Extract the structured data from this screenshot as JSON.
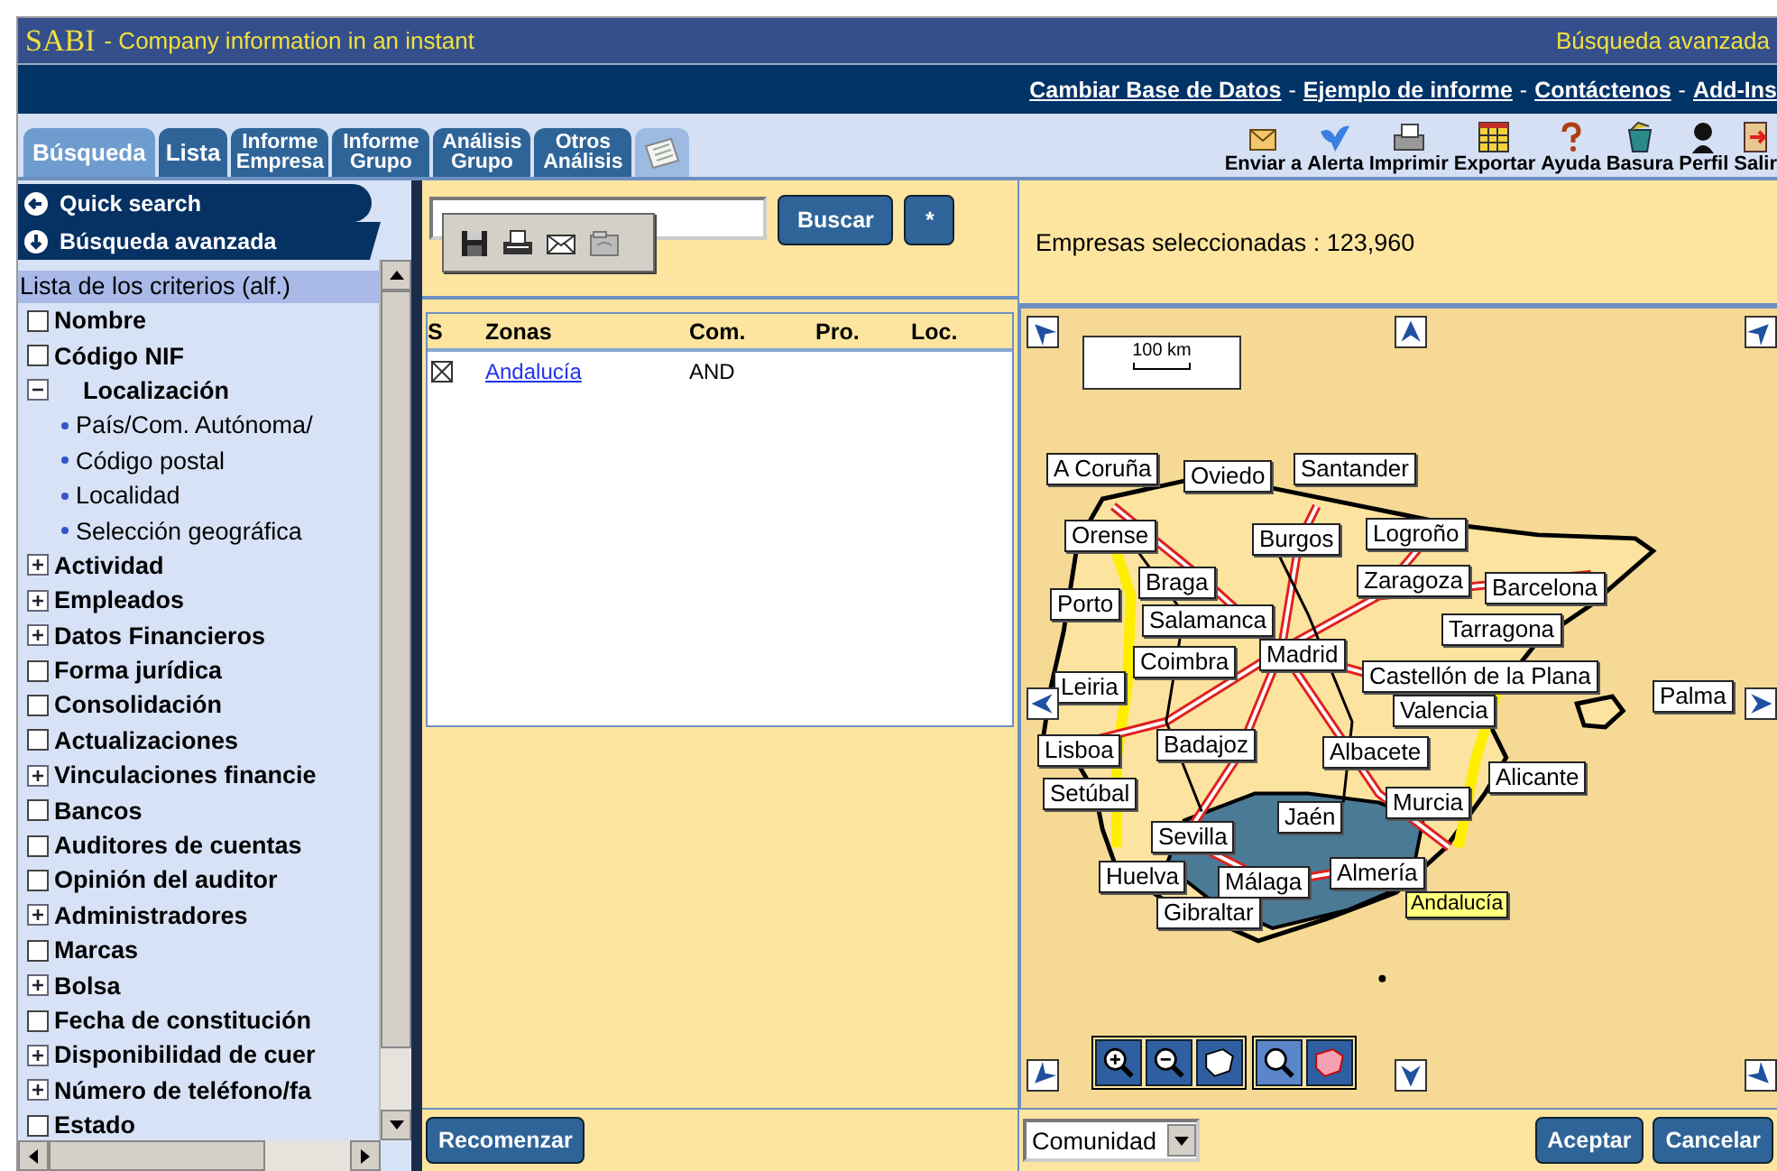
{
  "app_title": {
    "name": "SABI",
    "tagline": "- Company information in an instant",
    "mode": "Búsqueda avanzada"
  },
  "nav_links": [
    {
      "kind": "link",
      "label": "Cambiar Base de Datos"
    },
    {
      "kind": "separator",
      "label": "-"
    },
    {
      "kind": "link",
      "label": "Ejemplo de informe"
    },
    {
      "kind": "separator",
      "label": "-"
    },
    {
      "kind": "link",
      "label": "Contáctenos"
    },
    {
      "kind": "separator",
      "label": "-"
    },
    {
      "kind": "link",
      "label": "Add-Ins"
    }
  ],
  "tabs": [
    {
      "label": "Búsqueda",
      "selected": true
    },
    {
      "label": "Lista",
      "selected": false
    },
    {
      "label": "Informe Empresa",
      "selected": false
    },
    {
      "label": "Informe Grupo",
      "selected": false
    },
    {
      "label": "Análisis Grupo",
      "selected": false
    },
    {
      "label": "Otros Análisis",
      "selected": false
    }
  ],
  "toolbar": [
    {
      "kind": "send",
      "label": "Enviar a"
    },
    {
      "kind": "alert",
      "label": "Alerta"
    },
    {
      "kind": "print",
      "label": "Imprimir"
    },
    {
      "kind": "export",
      "label": "Exportar"
    },
    {
      "kind": "help",
      "label": "Ayuda"
    },
    {
      "kind": "trash",
      "label": "Basura"
    },
    {
      "kind": "profile",
      "label": "Perfil"
    },
    {
      "kind": "exit",
      "label": "Salir"
    }
  ],
  "sidebar": {
    "quick_search": "Quick search",
    "advanced_search": "Búsqueda avanzada",
    "list_title": "Lista de los criterios (alf.)",
    "criteria": [
      {
        "kind": "checkbox",
        "label": "Nombre",
        "checked": false
      },
      {
        "kind": "checkbox",
        "label": "Código NIF",
        "checked": false
      },
      {
        "kind": "group",
        "label": "Localización",
        "expanded": true,
        "children": [
          {
            "label": "País/Com. Autónoma/"
          },
          {
            "label": "Código postal"
          },
          {
            "label": "Localidad"
          },
          {
            "label": "Selección geográfica"
          }
        ]
      },
      {
        "kind": "group",
        "label": "Actividad",
        "expanded": false
      },
      {
        "kind": "group",
        "label": "Empleados",
        "expanded": false
      },
      {
        "kind": "group",
        "label": "Datos Financieros",
        "expanded": false
      },
      {
        "kind": "checkbox",
        "label": "Forma jurídica",
        "checked": false
      },
      {
        "kind": "checkbox",
        "label": "Consolidación",
        "checked": false
      },
      {
        "kind": "checkbox",
        "label": "Actualizaciones",
        "checked": false
      },
      {
        "kind": "group",
        "label": "Vinculaciones financie",
        "expanded": false
      },
      {
        "kind": "checkbox",
        "label": "Bancos",
        "checked": false
      },
      {
        "kind": "checkbox",
        "label": "Auditores de cuentas",
        "checked": false
      },
      {
        "kind": "checkbox",
        "label": "Opinión del auditor",
        "checked": false
      },
      {
        "kind": "group",
        "label": "Administradores",
        "expanded": false
      },
      {
        "kind": "checkbox",
        "label": "Marcas",
        "checked": false
      },
      {
        "kind": "group",
        "label": "Bolsa",
        "expanded": false
      },
      {
        "kind": "checkbox",
        "label": "Fecha de constitución",
        "checked": false
      },
      {
        "kind": "group",
        "label": "Disponibilidad de cuer",
        "expanded": false
      },
      {
        "kind": "group",
        "label": "Número de teléfono/fa",
        "expanded": false
      },
      {
        "kind": "checkbox",
        "label": "Estado",
        "checked": false
      }
    ]
  },
  "search": {
    "search_button": "Buscar",
    "star_button": "*"
  },
  "table": {
    "columns": [
      "S",
      "Zonas",
      "Com.",
      "Pro.",
      "Loc."
    ],
    "rows": [
      {
        "checked": true,
        "zone": "Andalucía",
        "com": "AND"
      }
    ]
  },
  "restart_button": "Recomenzar",
  "summary": "Empresas seleccionadas : 123,960",
  "map": {
    "scale": "100 km",
    "labels": [
      {
        "kind": "city",
        "text": "A Coruña"
      },
      {
        "kind": "city",
        "text": "Oviedo"
      },
      {
        "kind": "city",
        "text": "Santander"
      },
      {
        "kind": "city",
        "text": "Orense"
      },
      {
        "kind": "city",
        "text": "Burgos"
      },
      {
        "kind": "city",
        "text": "Logroño"
      },
      {
        "kind": "city",
        "text": "Braga"
      },
      {
        "kind": "city",
        "text": "Zaragoza"
      },
      {
        "kind": "city",
        "text": "Barcelona"
      },
      {
        "kind": "city",
        "text": "Porto"
      },
      {
        "kind": "city",
        "text": "Salamanca"
      },
      {
        "kind": "city",
        "text": "Tarragona"
      },
      {
        "kind": "city",
        "text": "Coimbra"
      },
      {
        "kind": "city",
        "text": "Madrid"
      },
      {
        "kind": "city",
        "text": "Castellón de la Plana"
      },
      {
        "kind": "city",
        "text": "Palma"
      },
      {
        "kind": "city",
        "text": "Leiria"
      },
      {
        "kind": "city",
        "text": "Valencia"
      },
      {
        "kind": "city",
        "text": "Lisboa"
      },
      {
        "kind": "city",
        "text": "Badajoz"
      },
      {
        "kind": "city",
        "text": "Albacete"
      },
      {
        "kind": "city",
        "text": "Alicante"
      },
      {
        "kind": "city",
        "text": "Setúbal"
      },
      {
        "kind": "city",
        "text": "Murcia"
      },
      {
        "kind": "city",
        "text": "Jaén"
      },
      {
        "kind": "city",
        "text": "Sevilla"
      },
      {
        "kind": "city",
        "text": "Huelva"
      },
      {
        "kind": "city",
        "text": "Málaga"
      },
      {
        "kind": "city",
        "text": "Almería"
      },
      {
        "kind": "city",
        "text": "Gibraltar"
      },
      {
        "kind": "region",
        "text": "Andalucía"
      }
    ]
  },
  "level_select": {
    "value": "Comunidad"
  },
  "accept_button": "Aceptar",
  "cancel_button": "Cancelar"
}
